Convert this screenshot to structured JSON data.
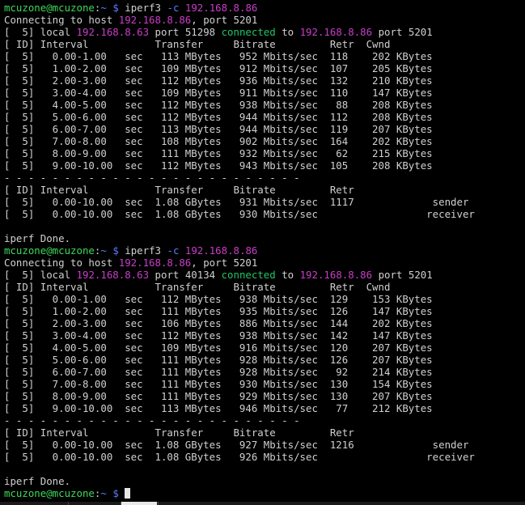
{
  "prompt": {
    "user": "mcuzone@mcuzone",
    "path": "~",
    "symbol": "$"
  },
  "lines": [
    {
      "kind": "prompt",
      "cmd": "iperf3",
      "flag": "-c",
      "arg": "192.168.8.86"
    },
    {
      "kind": "connecting",
      "pre": "Connecting to host ",
      "host": "192.168.8.86",
      "post": ", port 5201"
    },
    {
      "kind": "local",
      "pre": "[  5] local ",
      "lip": "192.168.8.63",
      "mid": " port 51298 ",
      "conn": "connected",
      "to": " to ",
      "rip": "192.168.8.86",
      "post": " port 5201"
    },
    {
      "kind": "text",
      "text": "[ ID] Interval           Transfer     Bitrate         Retr  Cwnd"
    },
    {
      "kind": "text",
      "text": "[  5]   0.00-1.00   sec   113 MBytes   952 Mbits/sec  118    202 KBytes"
    },
    {
      "kind": "text",
      "text": "[  5]   1.00-2.00   sec   109 MBytes   912 Mbits/sec  107    205 KBytes"
    },
    {
      "kind": "text",
      "text": "[  5]   2.00-3.00   sec   112 MBytes   936 Mbits/sec  132    210 KBytes"
    },
    {
      "kind": "text",
      "text": "[  5]   3.00-4.00   sec   109 MBytes   911 Mbits/sec  110    147 KBytes"
    },
    {
      "kind": "text",
      "text": "[  5]   4.00-5.00   sec   112 MBytes   938 Mbits/sec   88    208 KBytes"
    },
    {
      "kind": "text",
      "text": "[  5]   5.00-6.00   sec   112 MBytes   944 Mbits/sec  112    208 KBytes"
    },
    {
      "kind": "text",
      "text": "[  5]   6.00-7.00   sec   113 MBytes   944 Mbits/sec  119    207 KBytes"
    },
    {
      "kind": "text",
      "text": "[  5]   7.00-8.00   sec   108 MBytes   902 Mbits/sec  164    202 KBytes"
    },
    {
      "kind": "text",
      "text": "[  5]   8.00-9.00   sec   111 MBytes   932 Mbits/sec   62    215 KBytes"
    },
    {
      "kind": "text",
      "text": "[  5]   9.00-10.00  sec   112 MBytes   943 Mbits/sec  105    208 KBytes"
    },
    {
      "kind": "text",
      "text": "- - - - - - - - - - - - - - - - - - - - - - - - -"
    },
    {
      "kind": "text",
      "text": "[ ID] Interval           Transfer     Bitrate         Retr"
    },
    {
      "kind": "text",
      "text": "[  5]   0.00-10.00  sec  1.08 GBytes   931 Mbits/sec  1117             sender"
    },
    {
      "kind": "text",
      "text": "[  5]   0.00-10.00  sec  1.08 GBytes   930 Mbits/sec                  receiver"
    },
    {
      "kind": "text",
      "text": ""
    },
    {
      "kind": "text",
      "text": "iperf Done."
    },
    {
      "kind": "prompt",
      "cmd": "iperf3",
      "flag": "-c",
      "arg": "192.168.8.86"
    },
    {
      "kind": "connecting",
      "pre": "Connecting to host ",
      "host": "192.168.8.86",
      "post": ", port 5201"
    },
    {
      "kind": "local",
      "pre": "[  5] local ",
      "lip": "192.168.8.63",
      "mid": " port 40134 ",
      "conn": "connected",
      "to": " to ",
      "rip": "192.168.8.86",
      "post": " port 5201"
    },
    {
      "kind": "text",
      "text": "[ ID] Interval           Transfer     Bitrate         Retr  Cwnd"
    },
    {
      "kind": "text",
      "text": "[  5]   0.00-1.00   sec   112 MBytes   938 Mbits/sec  129    153 KBytes"
    },
    {
      "kind": "text",
      "text": "[  5]   1.00-2.00   sec   111 MBytes   935 Mbits/sec  126    147 KBytes"
    },
    {
      "kind": "text",
      "text": "[  5]   2.00-3.00   sec   106 MBytes   886 Mbits/sec  144    202 KBytes"
    },
    {
      "kind": "text",
      "text": "[  5]   3.00-4.00   sec   112 MBytes   938 Mbits/sec  142    147 KBytes"
    },
    {
      "kind": "text",
      "text": "[  5]   4.00-5.00   sec   109 MBytes   916 Mbits/sec  120    207 KBytes"
    },
    {
      "kind": "text",
      "text": "[  5]   5.00-6.00   sec   111 MBytes   928 Mbits/sec  126    207 KBytes"
    },
    {
      "kind": "text",
      "text": "[  5]   6.00-7.00   sec   111 MBytes   928 Mbits/sec   92    214 KBytes"
    },
    {
      "kind": "text",
      "text": "[  5]   7.00-8.00   sec   111 MBytes   930 Mbits/sec  130    154 KBytes"
    },
    {
      "kind": "text",
      "text": "[  5]   8.00-9.00   sec   111 MBytes   929 Mbits/sec  130    207 KBytes"
    },
    {
      "kind": "text",
      "text": "[  5]   9.00-10.00  sec   113 MBytes   946 Mbits/sec   77    212 KBytes"
    },
    {
      "kind": "text",
      "text": "- - - - - - - - - - - - - - - - - - - - - - - - -"
    },
    {
      "kind": "text",
      "text": "[ ID] Interval           Transfer     Bitrate         Retr"
    },
    {
      "kind": "text",
      "text": "[  5]   0.00-10.00  sec  1.08 GBytes   927 Mbits/sec  1216             sender"
    },
    {
      "kind": "text",
      "text": "[  5]   0.00-10.00  sec  1.08 GBytes   926 Mbits/sec                  receiver"
    },
    {
      "kind": "text",
      "text": ""
    },
    {
      "kind": "text",
      "text": "iperf Done."
    },
    {
      "kind": "prompt-active",
      "cmd": "",
      "flag": "",
      "arg": ""
    }
  ],
  "colors": {
    "background": "#000000",
    "foreground": "#d0d0d0",
    "user": "#3fd85a",
    "path": "#5d7cff",
    "ip": "#c83ec8",
    "connected": "#22c466"
  }
}
